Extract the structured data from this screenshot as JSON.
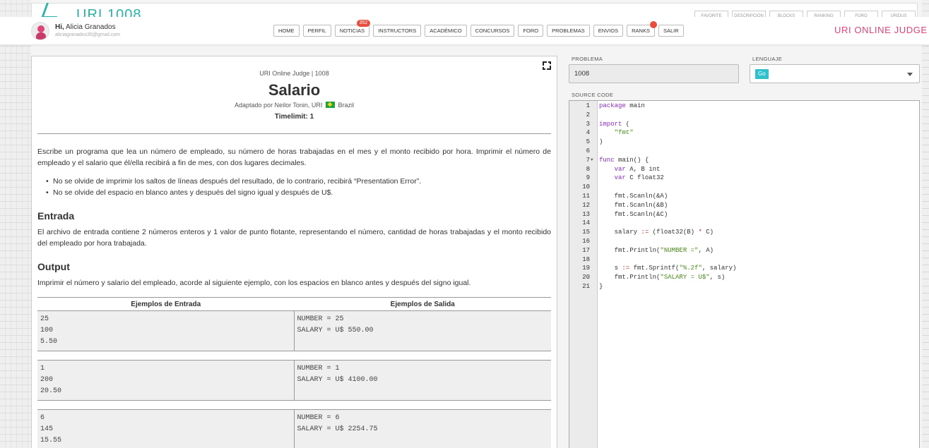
{
  "ghost_header": {
    "title": "URI 1008",
    "tabs": [
      "FAVORITE",
      "DESCRIPCIÓN",
      "BLOCKS",
      "RANKING",
      "FORO",
      "URIDUS"
    ]
  },
  "user": {
    "greeting_bold": "Hi,",
    "name": "Alicia Granados",
    "email": "aliciagranados35@gmail.com"
  },
  "nav": {
    "items": [
      {
        "label": "HOME"
      },
      {
        "label": "PERFIL"
      },
      {
        "label": "NOTICIAS",
        "badge": "352"
      },
      {
        "label": "INSTRUCTORS"
      },
      {
        "label": "ACADÉMICO"
      },
      {
        "label": "CONCURSOS"
      },
      {
        "label": "FORO"
      },
      {
        "label": "PROBLEMAS"
      },
      {
        "label": "ENVIOS"
      },
      {
        "label": "RANKS"
      },
      {
        "label": "SALIR"
      }
    ]
  },
  "brand": "URI ONLINE JUDGE",
  "problem": {
    "judge_line": "URI Online Judge | 1008",
    "title": "Salario",
    "adapted_prefix": "Adaptado por Neilor Tonin, URI",
    "adapted_country": "Brazil",
    "timelimit": "Timelimit: 1",
    "description": "Escribe un programa que lea un número de empleado, su número de horas trabajadas en el mes y el monto recibido por hora. Imprimir el número de empleado y el salario que él/ella recibirá a fin de mes, con dos lugares decimales.",
    "bullets": [
      "No se olvide de imprimir los saltos de líneas después del resultado, de lo contrario, recibirá “Presentation Error”.",
      "No se olvide del espacio en blanco antes y después del signo igual y después de U$."
    ],
    "input_heading": "Entrada",
    "input_text": "El archivo de entrada contiene 2 números enteros y 1 valor de punto flotante, representando el número, cantidad de horas trabajadas y el monto recibido del empleado por hora trabajada.",
    "output_heading": "Output",
    "output_text": "Imprimir el número y salario del empleado, acorde al siguiente ejemplo, con los espacios en blanco antes y después del signo igual.",
    "examples_header": {
      "input": "Ejemplos de Entrada",
      "output": "Ejemplos de Salida"
    },
    "examples": [
      {
        "input": "25\n100\n5.50",
        "output": "NUMBER = 25\nSALARY = U$ 550.00"
      },
      {
        "input": "1\n200\n20.50",
        "output": "NUMBER = 1\nSALARY = U$ 4100.00"
      },
      {
        "input": "6\n145\n15.55",
        "output": "NUMBER = 6\nSALARY = U$ 2254.75"
      }
    ]
  },
  "submit": {
    "problem_label": "PROBLEMA",
    "problem_value": "1008",
    "language_label": "LENGUAJE",
    "language_value": "Go",
    "source_label": "SOURCE CODE"
  },
  "source_code": [
    "package main",
    "",
    "import (",
    "    \"fmt\"",
    ")",
    "",
    "func main() {",
    "    var A, B int",
    "    var C float32",
    "",
    "    fmt.Scanln(&A)",
    "    fmt.Scanln(&B)",
    "    fmt.Scanln(&C)",
    "",
    "    salary := (float32(B) * C)",
    "",
    "    fmt.Println(\"NUMBER =\", A)",
    "",
    "    s := fmt.Sprintf(\"%.2f\", salary)",
    "    fmt.Println(\"SALARY = U$\", s)",
    "}"
  ],
  "colors": {
    "brand": "#e0427a",
    "badge": "#e74c3c",
    "language_chip": "#2fc1cc",
    "keyword": "#8a2bbf",
    "string": "#4a8a1a"
  },
  "icons": {
    "expand": "expand-icon",
    "flag": "brazil-flag-icon",
    "caret": "chevron-down-icon",
    "fold": "fold-arrow-icon"
  }
}
